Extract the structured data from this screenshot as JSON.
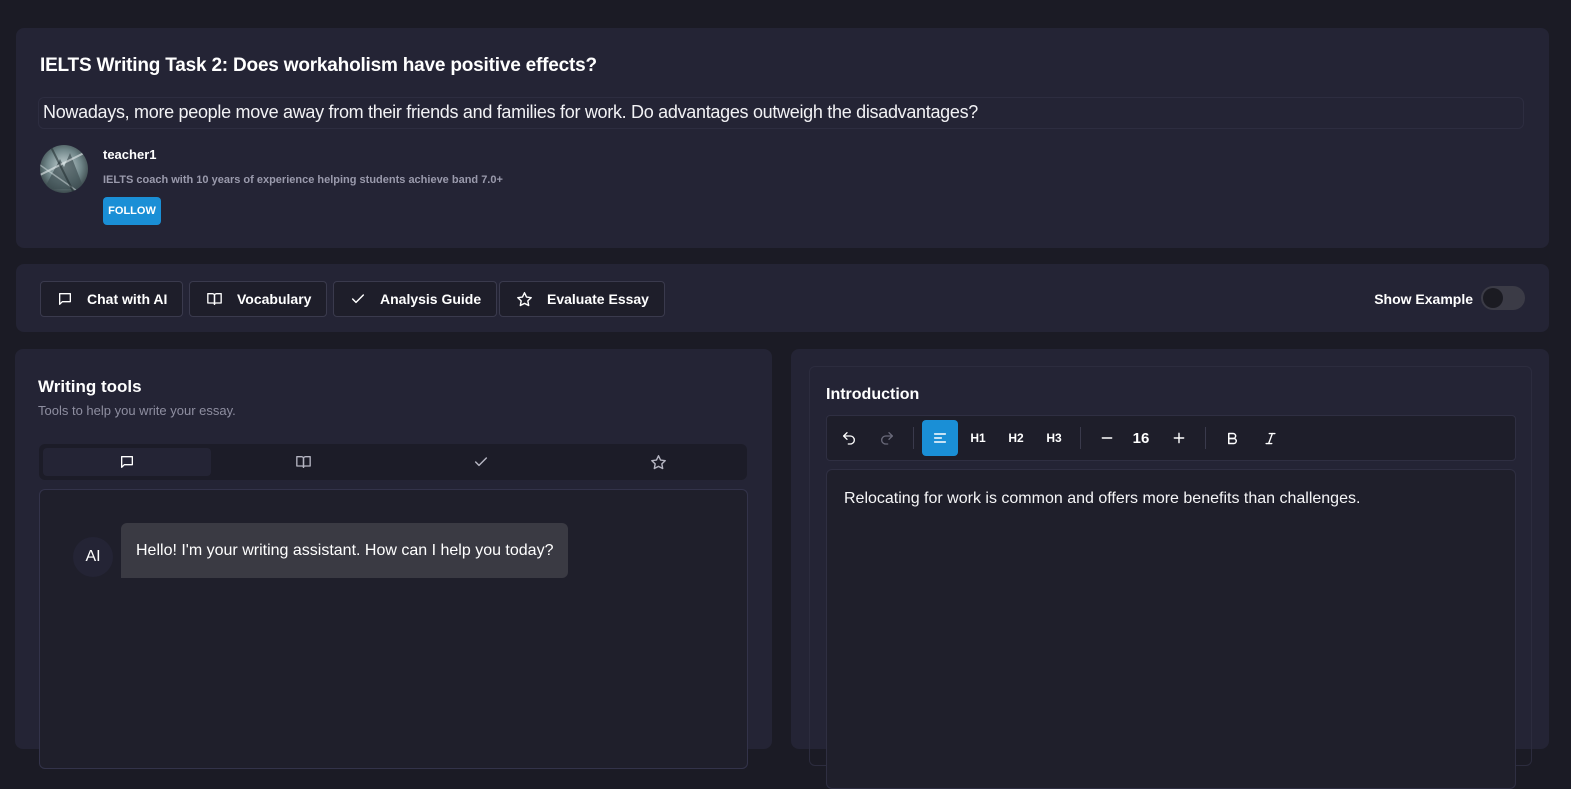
{
  "header": {
    "title": "IELTS Writing Task 2: Does workaholism have positive effects?",
    "prompt": "Nowadays, more people move away from their friends and families for work. Do advantages outweigh the disadvantages?",
    "author": {
      "name": "teacher1",
      "bio": "IELTS coach with 10 years of experience helping students achieve band 7.0+",
      "follow_label": "FOLLOW"
    }
  },
  "actions": {
    "buttons": [
      {
        "label": "Chat with AI",
        "icon": "chat-icon"
      },
      {
        "label": "Vocabulary",
        "icon": "book-icon"
      },
      {
        "label": "Analysis Guide",
        "icon": "check-icon"
      },
      {
        "label": "Evaluate Essay",
        "icon": "star-icon"
      }
    ],
    "show_example_label": "Show Example",
    "show_example_on": false
  },
  "writing_tools": {
    "title": "Writing tools",
    "subtitle": "Tools to help you write your essay.",
    "tabs": [
      {
        "icon": "chat-icon",
        "active": true
      },
      {
        "icon": "book-icon",
        "active": false
      },
      {
        "icon": "check-icon",
        "active": false
      },
      {
        "icon": "star-icon",
        "active": false
      }
    ],
    "chat": {
      "ai_label": "AI",
      "message": "Hello! I'm your writing assistant. How can I help you today?"
    }
  },
  "editor": {
    "section_title": "Introduction",
    "toolbar": {
      "h1": "H1",
      "h2": "H2",
      "h3": "H3",
      "font_size": "16"
    },
    "content": "Relocating for work is common and offers more benefits than challenges."
  },
  "colors": {
    "accent": "#1a8fd6",
    "background": "#1b1b25",
    "card": "#242435"
  }
}
